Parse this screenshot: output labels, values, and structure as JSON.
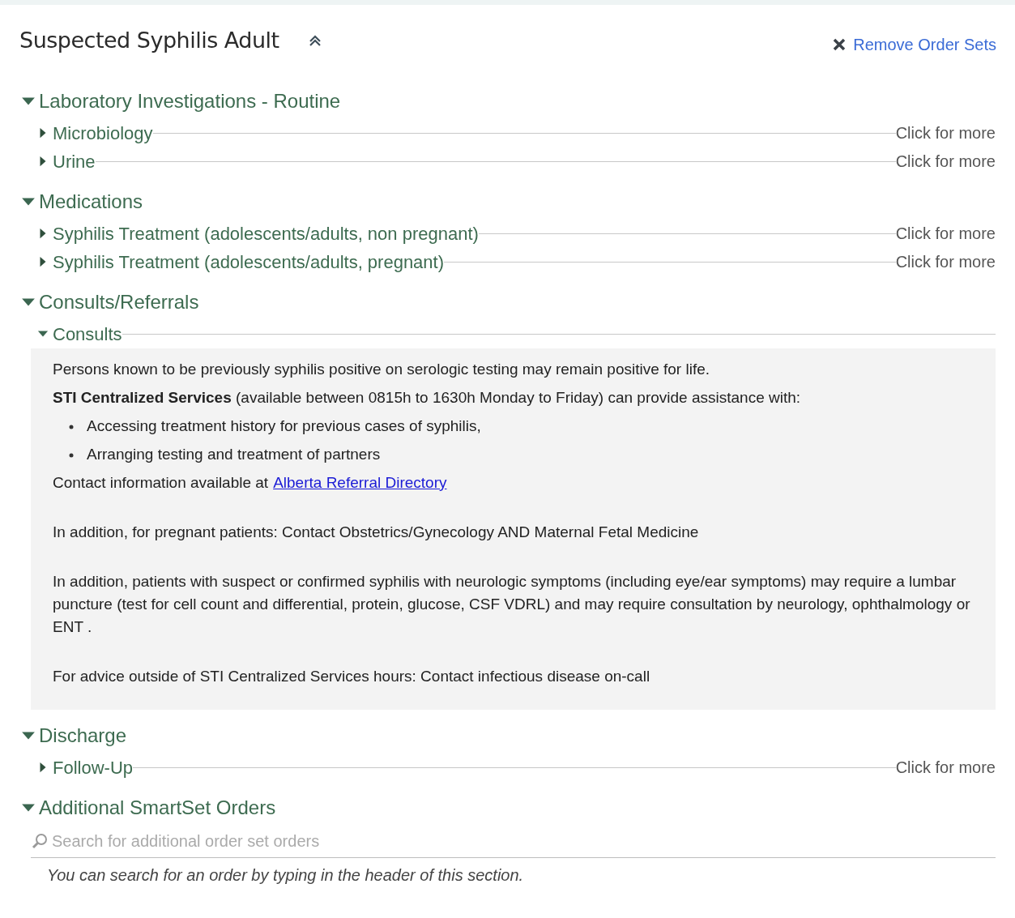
{
  "title": "Suspected Syphilis Adult",
  "remove_link": "Remove Order Sets",
  "sections": [
    {
      "label": "Laboratory Investigations - Routine",
      "expanded": true,
      "items": [
        {
          "label": "Microbiology",
          "expanded": false,
          "more": "Click for more"
        },
        {
          "label": "Urine",
          "expanded": false,
          "more": "Click for more"
        }
      ]
    },
    {
      "label": "Medications",
      "expanded": true,
      "items": [
        {
          "label": "Syphilis Treatment (adolescents/adults, non pregnant)",
          "expanded": false,
          "more": "Click for more"
        },
        {
          "label": "Syphilis Treatment (adolescents/adults, pregnant)",
          "expanded": false,
          "more": "Click for more"
        }
      ]
    },
    {
      "label": "Consults/Referrals",
      "expanded": true,
      "items": [
        {
          "label": "Consults",
          "expanded": true,
          "content": [
            {
              "kind": "line",
              "text": "Persons known to be previously syphilis positive on serologic testing may remain positive for life."
            },
            {
              "kind": "line",
              "text": "**STI Centralized Services** (available between 0815h to 1630h Monday to Friday) can provide assistance with:"
            },
            {
              "kind": "bullet",
              "text": "Accessing treatment history for previous cases of syphilis,"
            },
            {
              "kind": "bullet",
              "text": "Arranging testing and treatment of partners"
            },
            {
              "kind": "link",
              "text": "Contact information available at",
              "link": "Alberta Referral Directory"
            },
            {
              "kind": "paragraph",
              "text": "In addition, for pregnant patients: Contact Obstetrics/Gynecology AND Maternal Fetal Medicine"
            },
            {
              "kind": "paragraph",
              "text": "In addition, patients with suspect or confirmed syphilis with neurologic symptoms (including eye/ear symptoms) may require a lumbar puncture (test for cell count and differential, protein, glucose, CSF VDRL) and may require consultation by neurology, ophthalmology or ENT ."
            },
            {
              "kind": "paragraph",
              "text": "For advice outside of STI Centralized Services hours: Contact infectious disease on-call"
            }
          ]
        }
      ]
    },
    {
      "label": "Discharge",
      "expanded": true,
      "items": [
        {
          "label": "Follow-Up",
          "expanded": false,
          "more": "Click for more"
        }
      ]
    },
    {
      "label": "Additional SmartSet Orders",
      "expanded": true,
      "search": {
        "placeholder": "Search for additional order set orders"
      },
      "hint": "You can search for an order by typing in the header of this section."
    }
  ]
}
